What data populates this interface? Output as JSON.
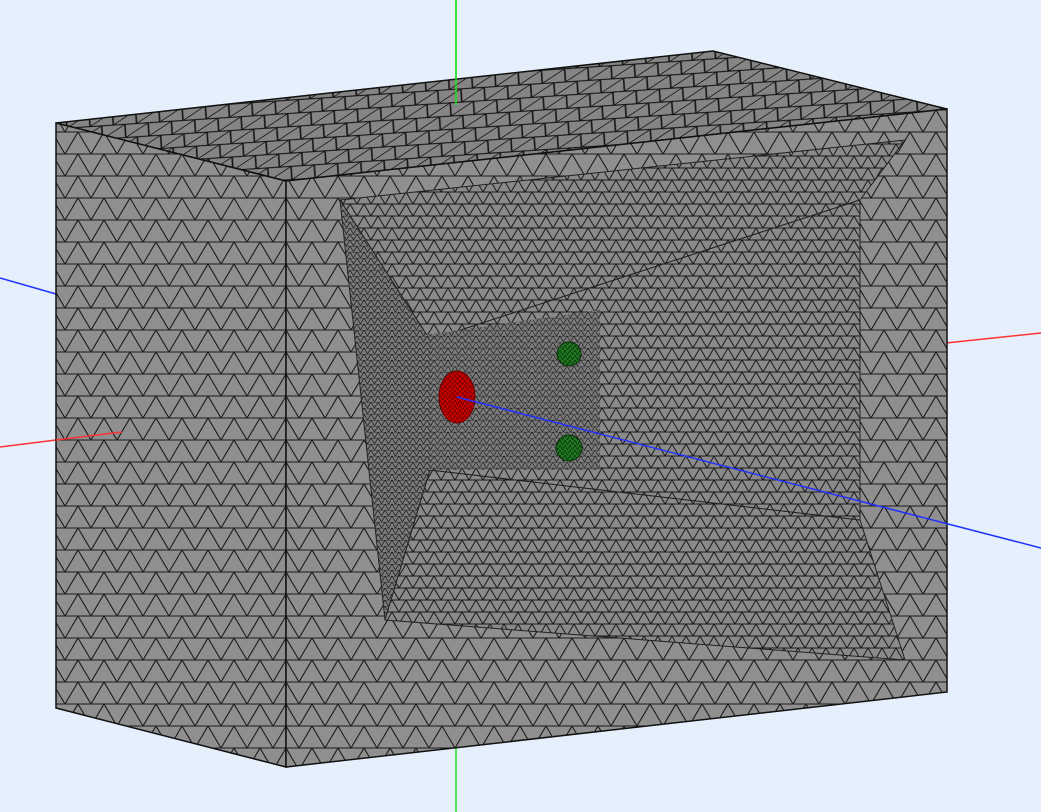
{
  "scene": {
    "background_color": "#e6f0fc",
    "model": {
      "type": "tetrahedral-mesh",
      "face_color": "#8c8c8c",
      "edge_color": "#1a1a1a",
      "shape": "rectangular box with tapered horn cavity"
    },
    "axes": {
      "x_color": "#ff3333",
      "y_color": "#22dd22",
      "z_color": "#2233ff"
    },
    "markers": [
      {
        "name": "source",
        "color": "#cc0000"
      },
      {
        "name": "probe",
        "color": "#1a7a1a"
      },
      {
        "name": "probe",
        "color": "#1a7a1a"
      }
    ]
  }
}
